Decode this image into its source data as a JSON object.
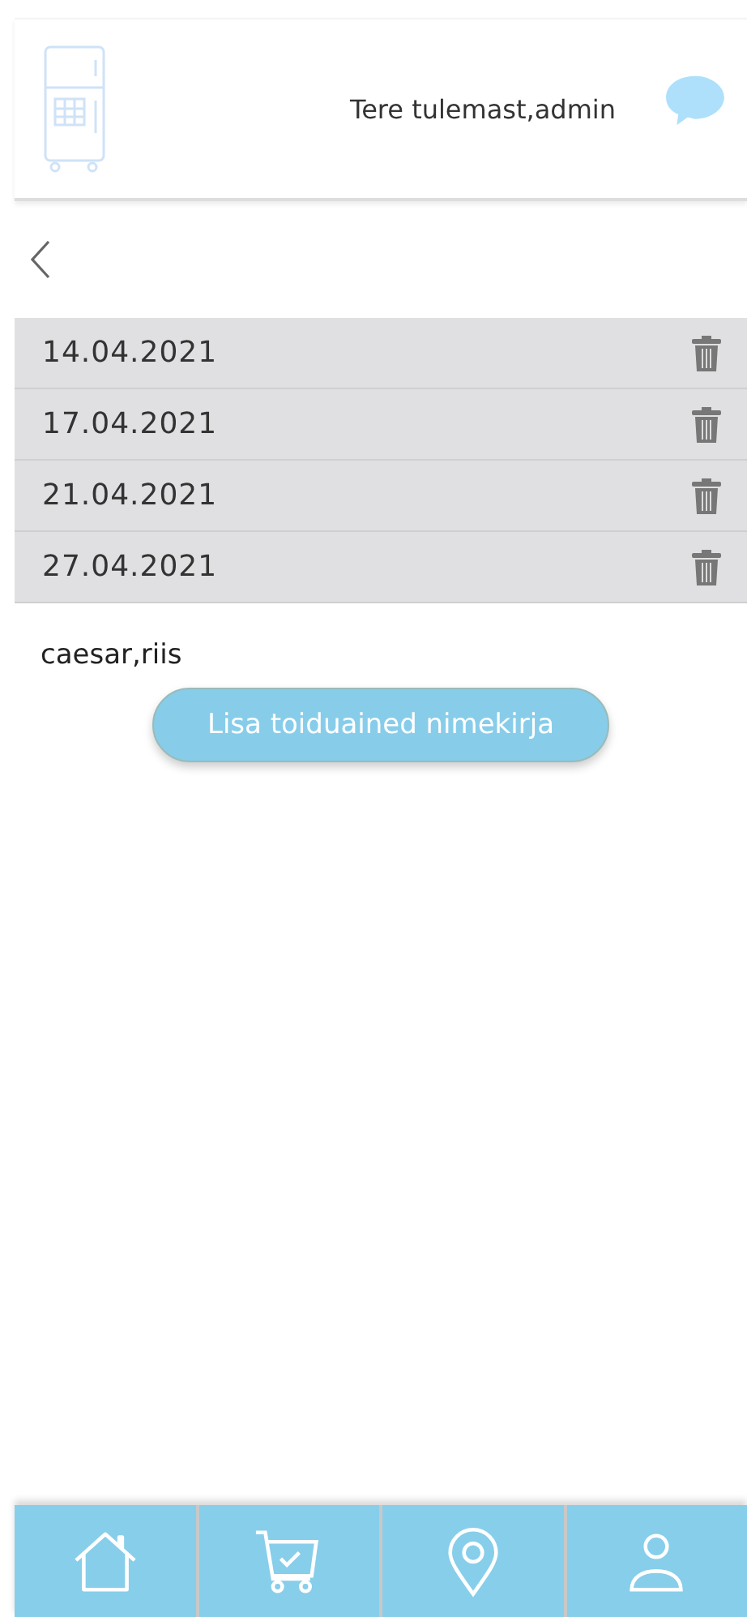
{
  "header": {
    "greeting": "Tere tulemast,admin"
  },
  "dates": [
    {
      "label": "14.04.2021"
    },
    {
      "label": "17.04.2021"
    },
    {
      "label": "21.04.2021"
    },
    {
      "label": "27.04.2021"
    }
  ],
  "ingredients": "caesar,riis",
  "add_button": "Lisa toiduained nimekirja",
  "nav": [
    {
      "kind": "home"
    },
    {
      "kind": "cart"
    },
    {
      "kind": "location"
    },
    {
      "kind": "profile"
    }
  ]
}
